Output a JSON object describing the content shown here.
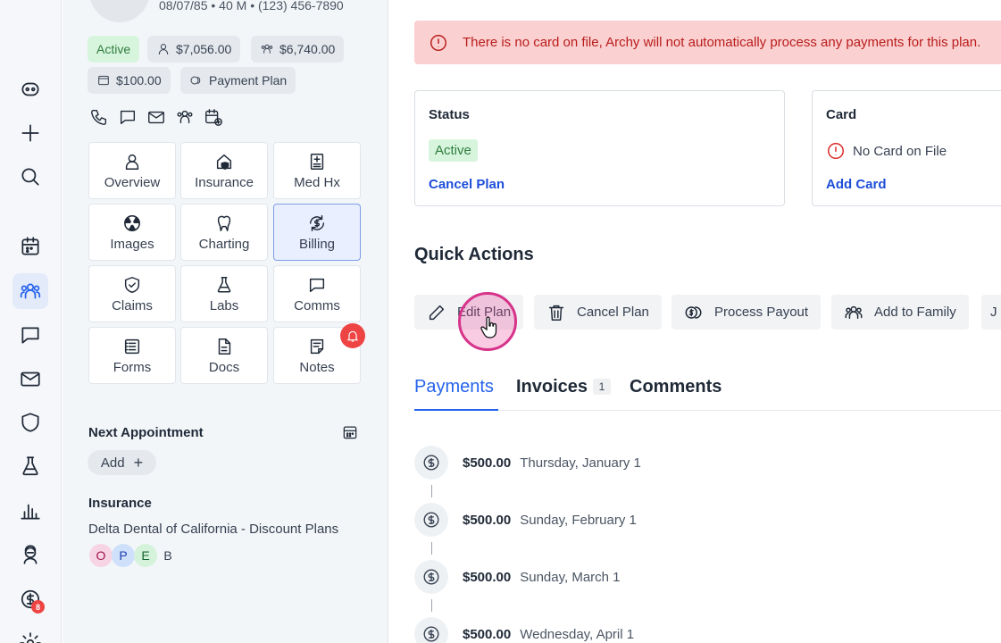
{
  "patient": {
    "demographics": "08/07/85 • 40 M • (123) 456-7890",
    "status_chip": "Active",
    "balance_1": "$7,056.00",
    "balance_2": "$6,740.00",
    "balance_3": "$100.00",
    "payment_plan_chip": "Payment Plan"
  },
  "tiles": [
    {
      "label": "Overview",
      "icon": "person-icon"
    },
    {
      "label": "Insurance",
      "icon": "house-shield-icon"
    },
    {
      "label": "Med Hx",
      "icon": "medical-record-icon"
    },
    {
      "label": "Images",
      "icon": "radiation-icon"
    },
    {
      "label": "Charting",
      "icon": "tooth-icon"
    },
    {
      "label": "Billing",
      "icon": "dollar-cycle-icon"
    },
    {
      "label": "Claims",
      "icon": "shield-check-icon"
    },
    {
      "label": "Labs",
      "icon": "flask-icon"
    },
    {
      "label": "Comms",
      "icon": "chat-icon"
    },
    {
      "label": "Forms",
      "icon": "forms-icon"
    },
    {
      "label": "Docs",
      "icon": "document-icon"
    },
    {
      "label": "Notes",
      "icon": "notes-icon"
    }
  ],
  "next_appointment": {
    "title": "Next Appointment",
    "add_label": "Add",
    "add_plus": "+"
  },
  "insurance": {
    "title": "Insurance",
    "name": "Delta Dental of California - Discount Plans",
    "badges": [
      "O",
      "P",
      "E",
      "B"
    ]
  },
  "rail": {
    "billing_badge": "8"
  },
  "alert": {
    "text": "There is no card on file, Archy will not automatically process any payments for this plan."
  },
  "status_card": {
    "title": "Status",
    "badge": "Active",
    "link": "Cancel Plan"
  },
  "card_card": {
    "title": "Card",
    "no_card": "No Card on File",
    "link": "Add Card"
  },
  "quick_actions": {
    "title": "Quick Actions",
    "buttons": [
      "Edit Plan",
      "Cancel Plan",
      "Process Payout",
      "Add to Family",
      "J"
    ]
  },
  "tabs": {
    "payments": "Payments",
    "invoices": "Invoices",
    "invoices_count": "1",
    "comments": "Comments"
  },
  "payments": [
    {
      "amount": "$500.00",
      "date": "Thursday, January 1"
    },
    {
      "amount": "$500.00",
      "date": "Sunday, February 1"
    },
    {
      "amount": "$500.00",
      "date": "Sunday, March 1"
    },
    {
      "amount": "$500.00",
      "date": "Wednesday, April 1"
    }
  ],
  "colors": {
    "accent": "#2563eb",
    "alert_bg": "#fbd0d0",
    "alert_text": "#b91c1c",
    "active_green": "#2f7d3e",
    "cursor_pink": "#d6338a"
  }
}
